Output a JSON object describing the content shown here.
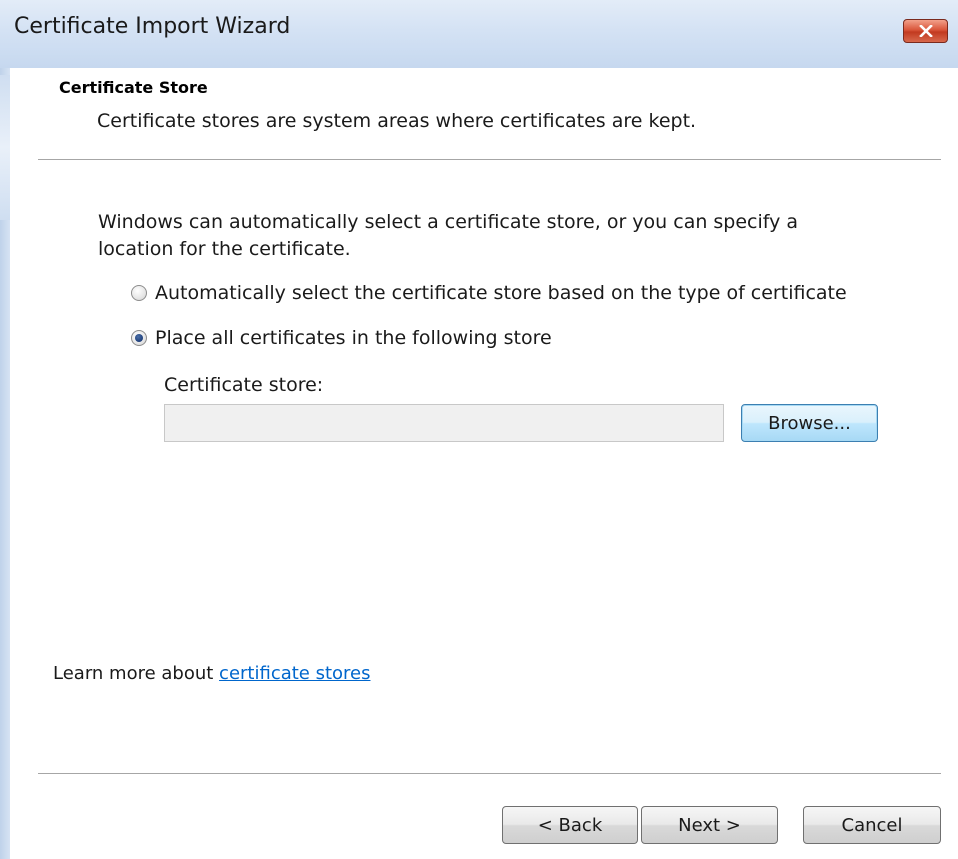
{
  "window": {
    "title": "Certificate Import Wizard",
    "close_icon": "close-icon"
  },
  "header": {
    "section_title": "Certificate Store",
    "section_description": "Certificate stores are system areas where certificates are kept."
  },
  "body": {
    "intro": "Windows can automatically select a certificate store, or you can specify a location for the certificate.",
    "options": [
      {
        "label": "Automatically select the certificate store based on the type of certificate",
        "selected": false
      },
      {
        "label": "Place all certificates in the following store",
        "selected": true
      }
    ],
    "store_label": "Certificate store:",
    "store_value": "",
    "browse_label": "Browse..."
  },
  "footer": {
    "learn_more_prefix": "Learn more about ",
    "learn_more_link": "certificate stores",
    "back_label": "< Back",
    "next_label": "Next >",
    "cancel_label": "Cancel"
  },
  "colors": {
    "titlebar": "#c6d8ef",
    "link": "#0066cc",
    "close_button": "#c23a20"
  }
}
